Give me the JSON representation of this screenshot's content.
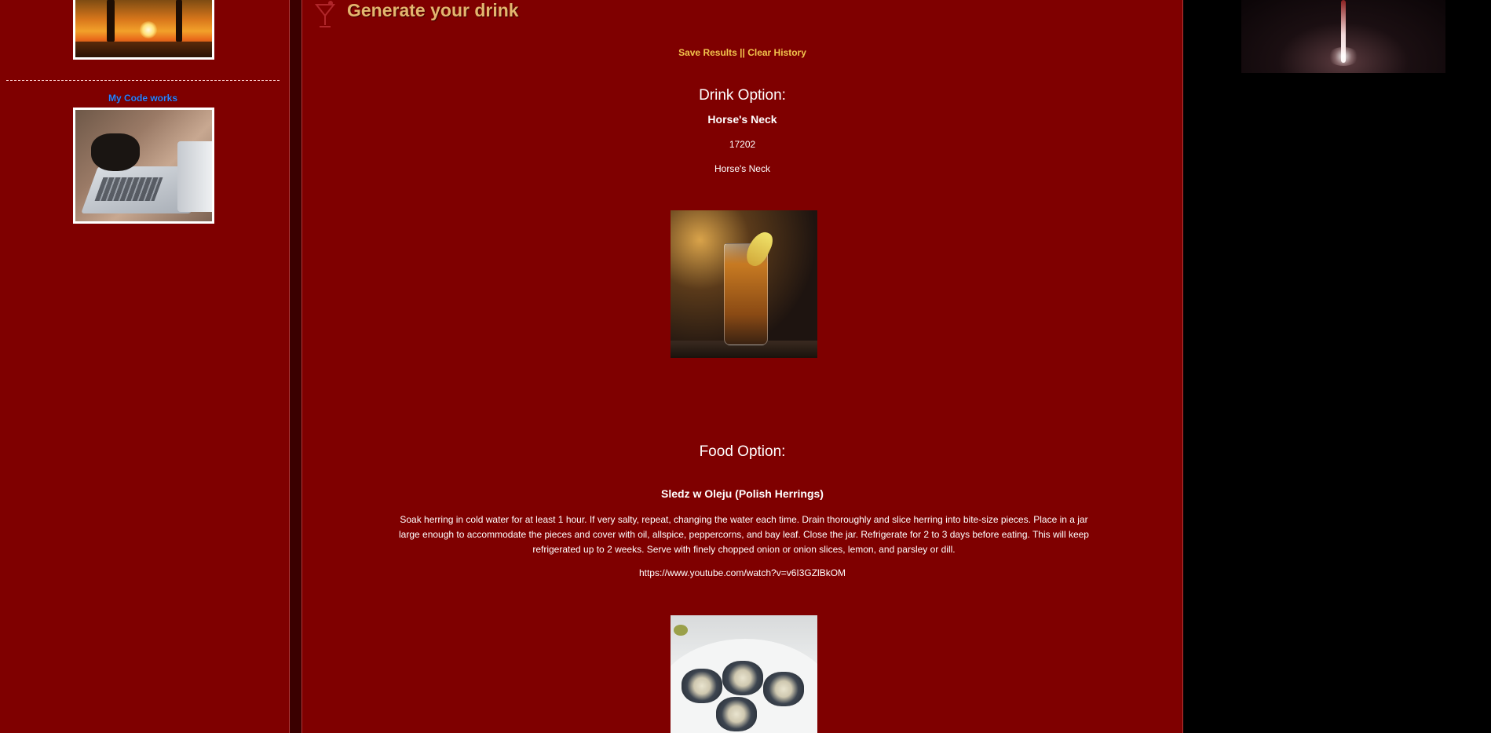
{
  "header": {
    "title": "Generate your drink",
    "icon": "cocktail-glass-icon"
  },
  "actions": {
    "save_label": "Save Results",
    "separator": "||",
    "clear_label": "Clear History"
  },
  "sidebar": {
    "code_title": "My Code works"
  },
  "drink": {
    "heading": "Drink Option:",
    "name": "Horse's Neck",
    "id": "17202",
    "name_repeat": "Horse's Neck"
  },
  "food": {
    "heading": "Food Option:",
    "name": "Sledz w Oleju (Polish Herrings)",
    "instructions": "Soak herring in cold water for at least 1 hour. If very salty, repeat, changing the water each time. Drain thoroughly and slice herring into bite-size pieces. Place in a jar large enough to accommodate the pieces and cover with oil, allspice, peppercorns, and bay leaf. Close the jar. Refrigerate for 2 to 3 days before eating. This will keep refrigerated up to 2 weeks. Serve with finely chopped onion or onion slices, lemon, and parsley or dill.",
    "video": "https://www.youtube.com/watch?v=v6I3GZlBkOM"
  },
  "colors": {
    "panel": "#7f0000",
    "title": "#e3b56e",
    "link": "#f2c44d",
    "code_title": "#2f80ff"
  }
}
